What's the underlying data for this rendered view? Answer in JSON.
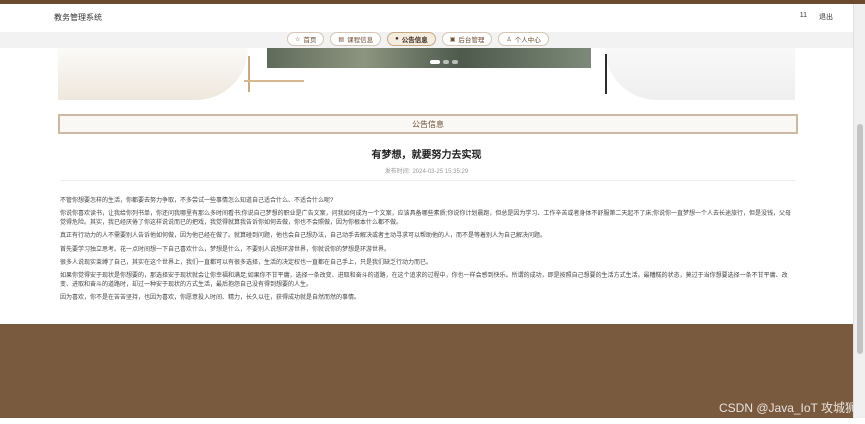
{
  "header": {
    "brand": "教务管理系统",
    "user": "11",
    "logout": "退出"
  },
  "nav": {
    "items": [
      {
        "icon": "☆",
        "label": "首页"
      },
      {
        "icon": "▤",
        "label": "课程信息"
      },
      {
        "icon": "●",
        "label": "公告信息"
      },
      {
        "icon": "▣",
        "label": "后台管理"
      },
      {
        "icon": "♙",
        "label": "个人中心"
      }
    ],
    "active": "公告信息"
  },
  "section": {
    "title": "公告信息"
  },
  "article": {
    "title": "有梦想，就要努力去实现",
    "meta_label": "发布时间:",
    "date": "2024-03-25 15:35:29",
    "paragraphs": [
      "不管你想要怎样的生活，你都要去努力争取，不多尝试一些事情怎么知道自己适合什么、不适合什么呢?",
      "你说你喜欢读书，让我给你列书单，你还问我哪里有那么多时间看书;你说自己梦想的职业是广告文案，问我如何成为一个文案，应该具备哪些素质;你说你计划晨跑，但总是因为学习、工作辛苦或者身体不舒服第二天起不了床;你说你一直梦想一个人去长途旅行，但是没钱，父母觉得危险。其实，我已经厌倦了你这样说说而已的把戏，我觉得就算我告诉你如何去做，你也不会照做，因为你根本什么都不做。",
      "真正有行动力的人不需要别人告诉他如何做，因为他已经在做了。就算碰到问题，他也会自己想办法，自己动手去解决或者主动寻求可以帮助他的人，而不是等着别人为自己解决问题。",
      "首先要学习独立思考。花一点时间想一下自己喜欢什么，梦想是什么，不要别人说想环游世界，你就说你的梦想是环游世界。",
      "很多人说现实束缚了自己，其实在这个世界上，我们一直都可以有很多选择，生活的决定权也一直都在自己手上，只是我们缺乏行动力而已。",
      "如果你觉得安于现状是你想要的，那选择安于现状就会让你幸福和满足;如果你不甘平庸，选择一条改变、进取和奋斗的道路，在这个追求的过程中，你也一样会感到快乐。所谓的成功，即是按照自己想要的生活方式生活。最糟糕的状态，莫过于当你想要选择一条不甘平庸、改变、进取和奋斗的道路时，却过一种安于现状的方式生活，最后抱怨自己没有得到想要的人生。",
      "因为喜欢，你不是在苦苦坚持，也因为喜欢，你愿意投入时间、精力，长久以往，获得成功就是自然而然的事情。"
    ]
  },
  "watermark": "CSDN @Java_IoT 攻城狮"
}
